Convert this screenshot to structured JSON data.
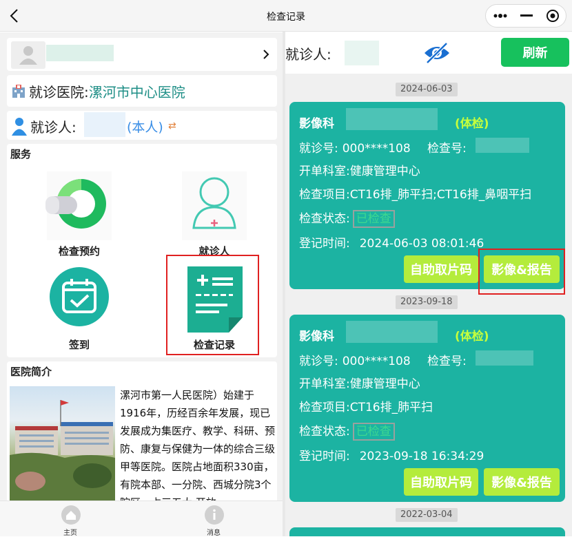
{
  "topbar": {
    "title": "检查记录"
  },
  "left": {
    "hospital_label": "就诊医院:",
    "hospital_name": "漯河市中心医院",
    "patient_label": "就诊人:",
    "patient_self": "(本人)",
    "patient_switch_glyph": "⇄",
    "services_title": "服务",
    "services": [
      {
        "label": "检查预约",
        "icon": "exam-appointment-icon"
      },
      {
        "label": "就诊人",
        "icon": "patient-profile-icon"
      },
      {
        "label": "签到",
        "icon": "calendar-checkin-icon"
      },
      {
        "label": "检查记录",
        "icon": "exam-record-icon"
      }
    ],
    "intro_title": "医院简介",
    "intro_text": "漯河市第一人民医院）始建于1916年，历经百余年发展，现已发展成为集医疗、教学、科研、预防、康复与保健为一体的综合三级甲等医院。医院占地面积330亩，有院本部、一分院、西城分院3个院区，占三五大 开放"
  },
  "bottom_nav": [
    {
      "label": "主页",
      "icon": "home-icon"
    },
    {
      "label": "消息",
      "icon": "info-icon"
    }
  ],
  "right": {
    "patient_label": "就诊人:",
    "refresh_label": "刷新",
    "records": [
      {
        "date": "2024-06-03",
        "dept": "影像科",
        "tag": "(体检)",
        "visit_no_label": "就诊号:",
        "visit_no": "000****108",
        "exam_no_label": "检查号:",
        "ordering_dept_label": "开单科室:",
        "ordering_dept": "健康管理中心",
        "items_label": "检查项目:",
        "items": "CT16排_肺平扫;CT16排_鼻咽平扫",
        "status_label": "检查状态:",
        "status": "已检查",
        "reg_time_label": "登记时间:",
        "reg_time": "2024-06-03 08:01:46",
        "btn_film": "自助取片码",
        "btn_report": "影像&报告"
      },
      {
        "date": "2023-09-18",
        "dept": "影像科",
        "tag": "(体检)",
        "visit_no_label": "就诊号:",
        "visit_no": "000****108",
        "exam_no_label": "检查号:",
        "ordering_dept_label": "开单科室:",
        "ordering_dept": "健康管理中心",
        "items_label": "检查项目:",
        "items": "CT16排_肺平扫",
        "status_label": "检查状态:",
        "status": "已检查",
        "reg_time_label": "登记时间:",
        "reg_time": "2023-09-18 16:34:29",
        "btn_film": "自助取片码",
        "btn_report": "影像&报告"
      }
    ],
    "next_date": "2022-03-04"
  },
  "colors": {
    "teal": "#1cb3a2",
    "green_button": "#17c15d",
    "lime_button": "#b4ec3c",
    "highlight_red": "#e02020"
  }
}
